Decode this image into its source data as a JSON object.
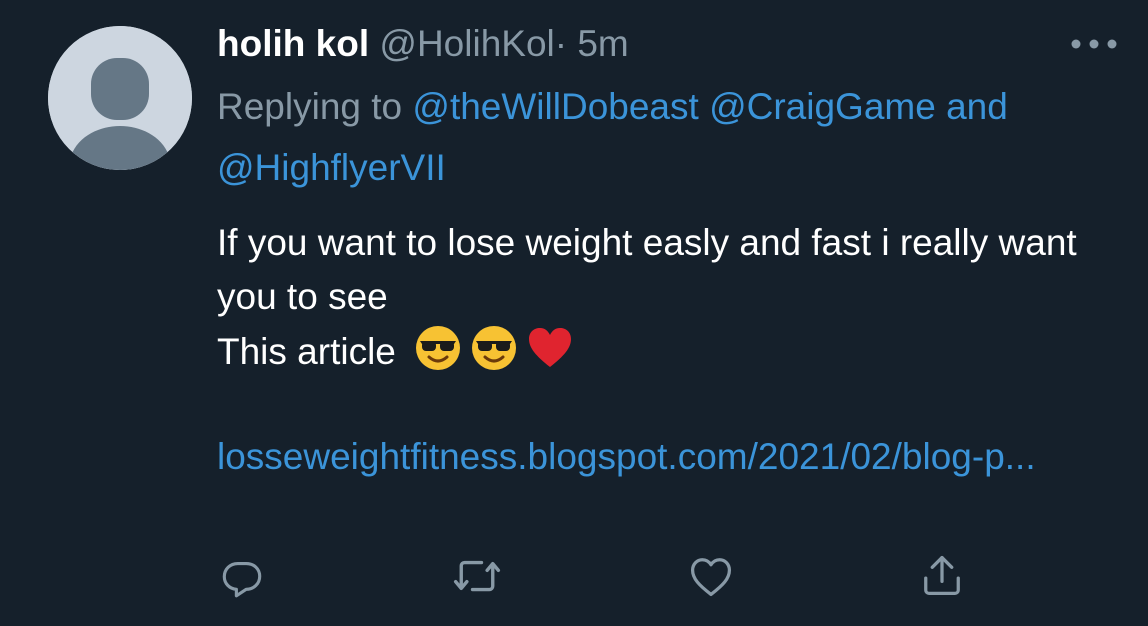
{
  "tweet": {
    "display_name": "holih kol",
    "handle": "@HolihKol",
    "separator": "·",
    "time": "5m",
    "replying_prefix": "Replying to",
    "reply_mention_1": "@theWillDobeast",
    "reply_mention_2": "@CraigGame",
    "reply_and": "and",
    "reply_mention_3": "@HighflyerVII",
    "text_line_1": "If you want to lose weight easly and fast i really want you to see",
    "text_line_2": "This article",
    "emojis": [
      "smiling-face-with-sunglasses",
      "smiling-face-with-sunglasses",
      "red-heart"
    ],
    "link_text": "losseweightfitness.blogspot.com/2021/02/blog-p..."
  },
  "icons": {
    "more": "more-horizontal-icon",
    "reply": "reply-icon",
    "retweet": "retweet-icon",
    "like": "heart-icon",
    "share": "share-icon"
  },
  "colors": {
    "background": "#15202b",
    "secondary_text": "#8899a6",
    "link": "#3b94d9",
    "primary_text": "#ffffff"
  }
}
